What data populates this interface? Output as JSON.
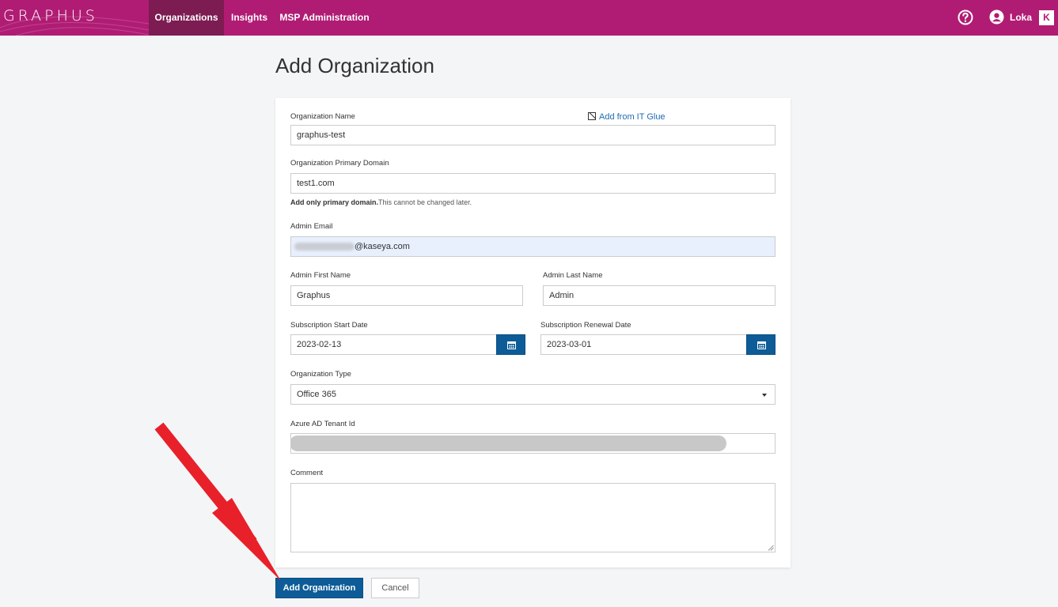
{
  "header": {
    "logo_text": "GRAPHUS",
    "nav": [
      "Organizations",
      "Insights",
      "MSP Administration"
    ],
    "active_nav": "Organizations",
    "user_name": "Loka",
    "brand_icon_text": "K"
  },
  "page": {
    "title": "Add Organization"
  },
  "form": {
    "org_name": {
      "label": "Organization Name",
      "value": "graphus-test"
    },
    "add_from_itglue": "Add from IT Glue",
    "primary_domain": {
      "label": "Organization Primary Domain",
      "value": "test1.com",
      "help_bold": "Add only primary domain.",
      "help_rest": "This cannot be changed later."
    },
    "admin_email": {
      "label": "Admin Email",
      "value_suffix": "@kaseya.com"
    },
    "admin_first_name": {
      "label": "Admin First Name",
      "value": "Graphus"
    },
    "admin_last_name": {
      "label": "Admin Last Name",
      "value": "Admin"
    },
    "sub_start": {
      "label": "Subscription Start Date",
      "value": "2023-02-13"
    },
    "sub_renewal": {
      "label": "Subscription Renewal Date",
      "value": "2023-03-01"
    },
    "org_type": {
      "label": "Organization Type",
      "value": "Office 365"
    },
    "azure_tenant": {
      "label": "Azure AD Tenant Id",
      "value": ""
    },
    "comment": {
      "label": "Comment",
      "value": ""
    }
  },
  "actions": {
    "submit": "Add Organization",
    "cancel": "Cancel"
  },
  "icons": [
    "help-icon",
    "user-icon",
    "kaseya-logo-icon",
    "itglue-icon",
    "calendar-icon",
    "caret-down-icon",
    "resize-grip-icon",
    "red-arrow-annotation"
  ],
  "colors": {
    "header": "#b01c74",
    "active_nav": "#7c1c52",
    "primary": "#0d5c97",
    "annotation_arrow": "#e8202a"
  }
}
